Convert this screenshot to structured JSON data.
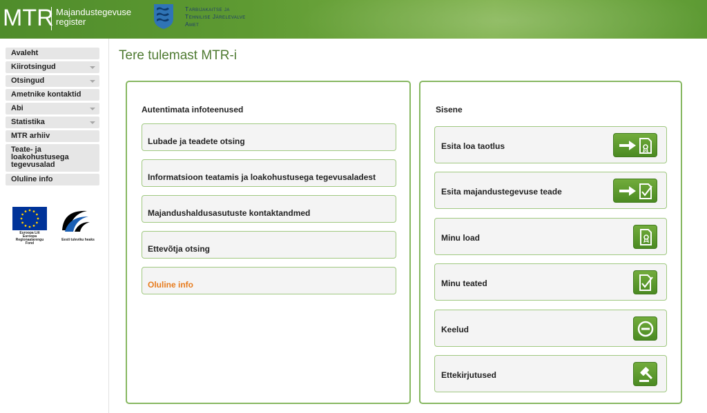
{
  "header": {
    "logo_main": "MTR",
    "logo_sub_line1": "Majandustegevuse",
    "logo_sub_line2": "register",
    "agency_line1": "Tarbijakaitse ja",
    "agency_line2": "Tehnilise Järelevalve",
    "agency_line3": "Amet"
  },
  "sidebar": {
    "items": [
      {
        "label": "Avaleht",
        "has_submenu": false
      },
      {
        "label": "Kiirotsingud",
        "has_submenu": true
      },
      {
        "label": "Otsingud",
        "has_submenu": true
      },
      {
        "label": "Ametnike kontaktid",
        "has_submenu": false
      },
      {
        "label": "Abi",
        "has_submenu": true
      },
      {
        "label": "Statistika",
        "has_submenu": true
      },
      {
        "label": "MTR arhiiv",
        "has_submenu": false
      },
      {
        "label": "Teate- ja loakohustusega tegevusalad",
        "has_submenu": false
      },
      {
        "label": "Oluline info",
        "has_submenu": false
      }
    ],
    "eu_caption_line1": "Euroopa Liit",
    "eu_caption_line2": "Euroopa",
    "eu_caption_line3": "Regionaalarengu Fond",
    "est_caption": "Eesti tuleviku heaks"
  },
  "main": {
    "title": "Tere tulemast MTR-i",
    "left_panel": {
      "heading": "Autentimata infoteenused",
      "links": [
        {
          "label": "Lubade ja teadete otsing"
        },
        {
          "label": "Informatsioon teatamis ja loakohustusega tegevusaladest"
        },
        {
          "label": "Majandushaldusasutuste kontaktandmed"
        },
        {
          "label": "Ettevõtja otsing"
        },
        {
          "label": "Oluline info"
        }
      ]
    },
    "right_panel": {
      "heading": "Sisene",
      "actions": [
        {
          "label": "Esita loa taotlus",
          "icon": "arrow-license-icon"
        },
        {
          "label": "Esita majandustegevuse teade",
          "icon": "arrow-checkdoc-icon"
        },
        {
          "label": "Minu load",
          "icon": "license-doc-icon"
        },
        {
          "label": "Minu teated",
          "icon": "check-doc-icon"
        },
        {
          "label": "Keelud",
          "icon": "prohibition-icon"
        },
        {
          "label": "Ettekirjutused",
          "icon": "gavel-icon"
        }
      ]
    }
  },
  "colors": {
    "header_green": "#5e9a32",
    "title_green": "#4e7a31",
    "panel_border": "#86b760",
    "button_green": "#5c9b2e",
    "orange_link": "#e77b1c"
  }
}
